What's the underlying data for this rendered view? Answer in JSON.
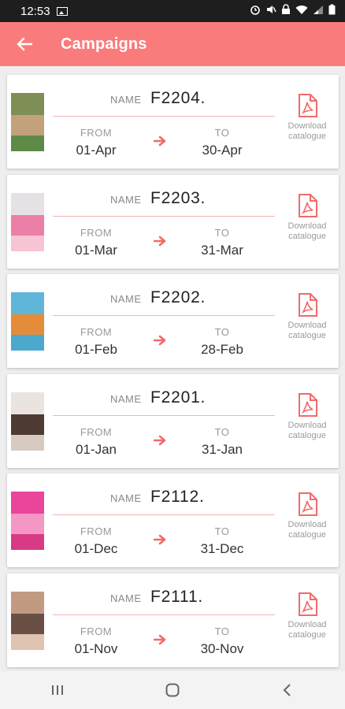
{
  "status_bar": {
    "time": "12:53",
    "icons": [
      "image-icon",
      "alarm-icon",
      "mute-icon",
      "lock-icon",
      "wifi-icon",
      "signal-icon",
      "battery-icon"
    ]
  },
  "app_bar": {
    "title": "Campaigns",
    "back_icon": "arrow-left-icon",
    "background": "#fa7b7b"
  },
  "labels": {
    "name": "NAME",
    "from": "FROM",
    "to": "TO",
    "download_line1": "Download",
    "download_line2": "catalogue"
  },
  "campaigns": [
    {
      "name": "F2204.",
      "from": "01-Apr",
      "to": "30-Apr",
      "cover_colors": [
        "#7f8e55",
        "#c2a27c",
        "#5e8a47"
      ]
    },
    {
      "name": "F2203.",
      "from": "01-Mar",
      "to": "31-Mar",
      "cover_colors": [
        "#e6e1e4",
        "#ec7fa7",
        "#f7c4d4"
      ]
    },
    {
      "name": "F2202.",
      "from": "01-Feb",
      "to": "28-Feb",
      "cover_colors": [
        "#5fb6d8",
        "#e58c3b",
        "#4aa9cc"
      ]
    },
    {
      "name": "F2201.",
      "from": "01-Jan",
      "to": "31-Jan",
      "cover_colors": [
        "#e9e4df",
        "#4e3b33",
        "#d7cbc1"
      ]
    },
    {
      "name": "F2112.",
      "from": "01-Dec",
      "to": "31-Dec",
      "cover_colors": [
        "#e8459b",
        "#f597c4",
        "#d93a85"
      ]
    },
    {
      "name": "F2111.",
      "from": "01-Nov",
      "to": "30-Nov",
      "cover_colors": [
        "#c29a82",
        "#6a4f44",
        "#e0c3b0"
      ]
    }
  ],
  "accent_color": "#f06b6b",
  "nav_bar": [
    "recent-apps-icon",
    "home-icon",
    "back-icon"
  ]
}
